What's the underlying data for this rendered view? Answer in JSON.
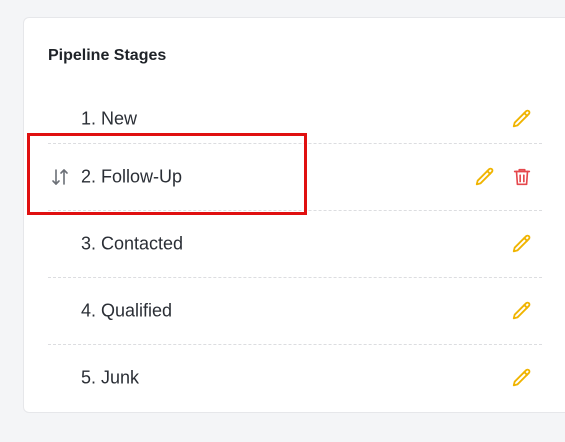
{
  "panel": {
    "title": "Pipeline Stages"
  },
  "colors": {
    "edit_icon": "#f0b400",
    "delete_icon": "#e5484d",
    "highlight": "#e01010"
  },
  "stages": [
    {
      "label": "1. New",
      "draggable": false,
      "deletable": false
    },
    {
      "label": "2. Follow-Up",
      "draggable": true,
      "deletable": true
    },
    {
      "label": "3. Contacted",
      "draggable": false,
      "deletable": false
    },
    {
      "label": "4. Qualified",
      "draggable": false,
      "deletable": false
    },
    {
      "label": "5. Junk",
      "draggable": false,
      "deletable": false
    }
  ],
  "icons": {
    "drag": "sort-arrows-icon",
    "edit": "pencil-icon",
    "delete": "trash-icon"
  }
}
